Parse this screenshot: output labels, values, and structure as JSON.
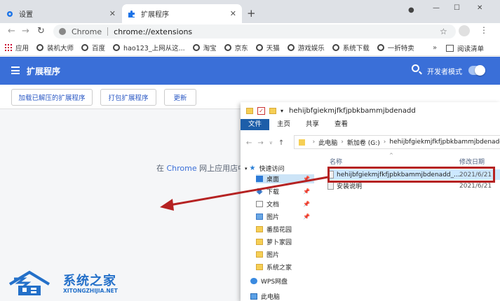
{
  "browser": {
    "tabs": [
      {
        "label": "设置",
        "icon": "gear-icon",
        "active": false
      },
      {
        "label": "扩展程序",
        "icon": "puzzle-icon",
        "active": true
      }
    ],
    "omnibox": {
      "site": "Chrome",
      "url": "chrome://extensions"
    },
    "bookmarks": [
      {
        "label": "应用",
        "icon": "apps-icon"
      },
      {
        "label": "装机大师"
      },
      {
        "label": "百度"
      },
      {
        "label": "hao123_上网从这..."
      },
      {
        "label": "淘宝"
      },
      {
        "label": "京东"
      },
      {
        "label": "天猫"
      },
      {
        "label": "游戏娱乐"
      },
      {
        "label": "系统下载"
      },
      {
        "label": "一折特卖"
      }
    ],
    "reading_list": "阅读清单"
  },
  "extensions": {
    "title": "扩展程序",
    "dev_mode_label": "开发者模式",
    "dev_mode_on": true,
    "buttons": {
      "load_unpacked": "加载已解压的扩展程序",
      "pack": "打包扩展程序",
      "update": "更新"
    },
    "webstore_prefix": "在",
    "webstore_link": "Chrome",
    "webstore_suffix": "网上应用店中"
  },
  "explorer": {
    "title": "hehijbfgiekmjfkfjpbkbammjbdenadd",
    "ribbon_tabs": [
      "文件",
      "主页",
      "共享",
      "查看"
    ],
    "breadcrumb": [
      "此电脑",
      "新加卷 (G:)",
      "hehijbfgiekmjfkfjpbkbammjbdenadd"
    ],
    "nav_items": [
      {
        "label": "快速访问",
        "icon": "star-icon"
      },
      {
        "label": "桌面",
        "icon": "desktop-icon"
      },
      {
        "label": "下载",
        "icon": "download-icon"
      },
      {
        "label": "文档",
        "icon": "document-icon"
      },
      {
        "label": "图片",
        "icon": "picture-icon"
      },
      {
        "label": "番茄花园",
        "icon": "folder-icon"
      },
      {
        "label": "萝卜家园",
        "icon": "folder-icon"
      },
      {
        "label": "图片",
        "icon": "folder-icon"
      },
      {
        "label": "系统之家",
        "icon": "folder-icon"
      },
      {
        "label": "WPS网盘",
        "icon": "cloud-icon"
      },
      {
        "label": "此电脑",
        "icon": "computer-icon"
      }
    ],
    "columns": {
      "name": "名称",
      "date": "修改日期"
    },
    "files": [
      {
        "name": "hehijbfgiekmjfkfjpbkbammjbdenadd_...",
        "date": "2021/6/21"
      },
      {
        "name": "安装说明",
        "date": "2021/6/21"
      }
    ]
  },
  "watermark": {
    "name_cn": "系统之家",
    "name_en": "XITONGZHIJIA.NET"
  },
  "colors": {
    "header_blue": "#3a6fd8",
    "annotation_red": "#b52222",
    "ribbon_file_blue": "#1d5ea9"
  }
}
